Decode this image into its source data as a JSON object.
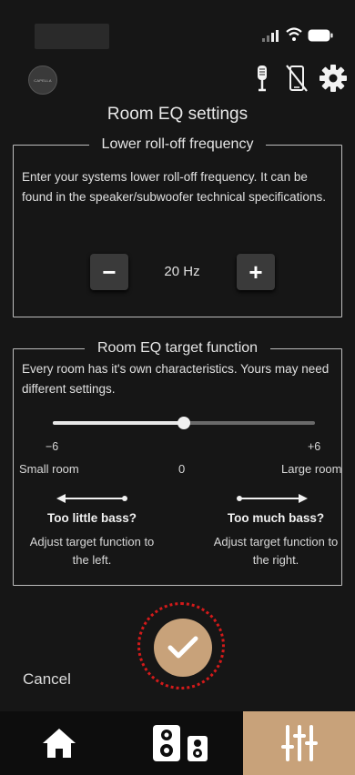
{
  "header": {
    "logo_text": "CAPELLA"
  },
  "page": {
    "title": "Room EQ settings"
  },
  "rolloff": {
    "legend": "Lower roll-off frequency",
    "description": "Enter your systems lower roll-off frequency. It can be found in the speaker/subwoofer technical specifications.",
    "value": "20 Hz",
    "minus_label": "−",
    "plus_label": "+"
  },
  "target": {
    "legend": "Room EQ target function",
    "description": "Every room has it's own characteristics. Yours may need different settings.",
    "slider": {
      "min": -6,
      "max": 6,
      "value": 0
    },
    "tick_min": "−6",
    "tick_max": "+6",
    "label_small": "Small room",
    "label_zero": "0",
    "label_large": "Large room",
    "left_tip_title": "Too little bass?",
    "left_tip_body": "Adjust target function to the left.",
    "right_tip_title": "Too much bass?",
    "right_tip_body": "Adjust target function to the right."
  },
  "actions": {
    "cancel_label": "Cancel"
  },
  "colors": {
    "accent": "#c8a27a",
    "highlight_ring": "#d21a1a",
    "background": "#161616"
  },
  "tabs": [
    {
      "icon": "home-icon",
      "active": false
    },
    {
      "icon": "speakers-icon",
      "active": false
    },
    {
      "icon": "equalizer-icon",
      "active": true
    }
  ]
}
